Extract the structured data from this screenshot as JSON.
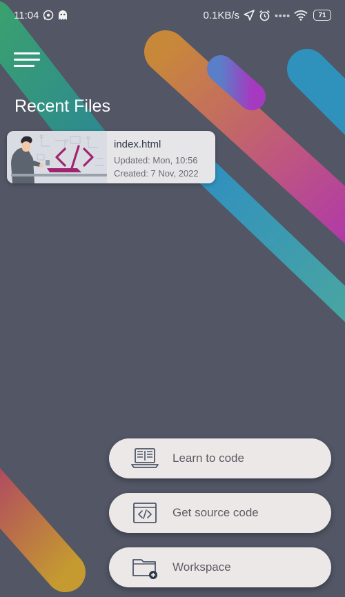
{
  "status_bar": {
    "time": "11:04",
    "left_icons": [
      "whatsapp-icon",
      "ghost-icon"
    ],
    "net_speed": "0.1KB/s",
    "right_icons": [
      "location-arrow-icon",
      "alarm-icon",
      "dots-icon",
      "wifi-icon",
      "battery-icon"
    ],
    "battery": "71"
  },
  "header": {
    "menu_icon": "hamburger-menu-icon",
    "title": "Recent Files"
  },
  "recent_files": [
    {
      "name": "index.html",
      "updated": "Updated: Mon, 10:56",
      "created": "Created: 7 Nov, 2022",
      "thumbnail_icon": "developer-code-illustration"
    }
  ],
  "actions": [
    {
      "label": "Learn to code",
      "icon": "laptop-book-icon"
    },
    {
      "label": "Get source code",
      "icon": "code-window-icon"
    },
    {
      "label": "Workspace",
      "icon": "folder-add-icon"
    }
  ],
  "colors": {
    "background": "#525665",
    "card": "#e6e6e8",
    "button": "#ede8e8",
    "accent_purple": "#a0246f"
  }
}
